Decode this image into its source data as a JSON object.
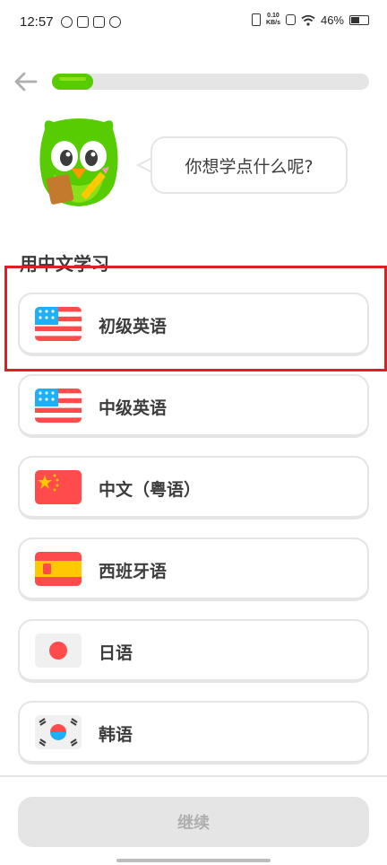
{
  "status_bar": {
    "time": "12:57",
    "net_speed_value": "0.10",
    "net_speed_unit": "KB/s",
    "battery": "46%"
  },
  "header": {
    "progress_percent": 13
  },
  "mascot": {
    "speech": "你想学点什么呢?"
  },
  "section": {
    "title": "用中文学习"
  },
  "courses": [
    {
      "name": "初级英语",
      "flag": "us-flag-icon"
    },
    {
      "name": "中级英语",
      "flag": "us-flag-icon"
    },
    {
      "name": "中文（粤语）",
      "flag": "china-flag-icon"
    },
    {
      "name": "西班牙语",
      "flag": "spain-flag-icon"
    },
    {
      "name": "日语",
      "flag": "japan-flag-icon"
    },
    {
      "name": "韩语",
      "flag": "korea-flag-icon"
    }
  ],
  "footer": {
    "continue_label": "继续"
  },
  "colors": {
    "brand_green": "#58cc02",
    "highlight_red": "#e02020",
    "card_border": "#e5e5e5"
  }
}
